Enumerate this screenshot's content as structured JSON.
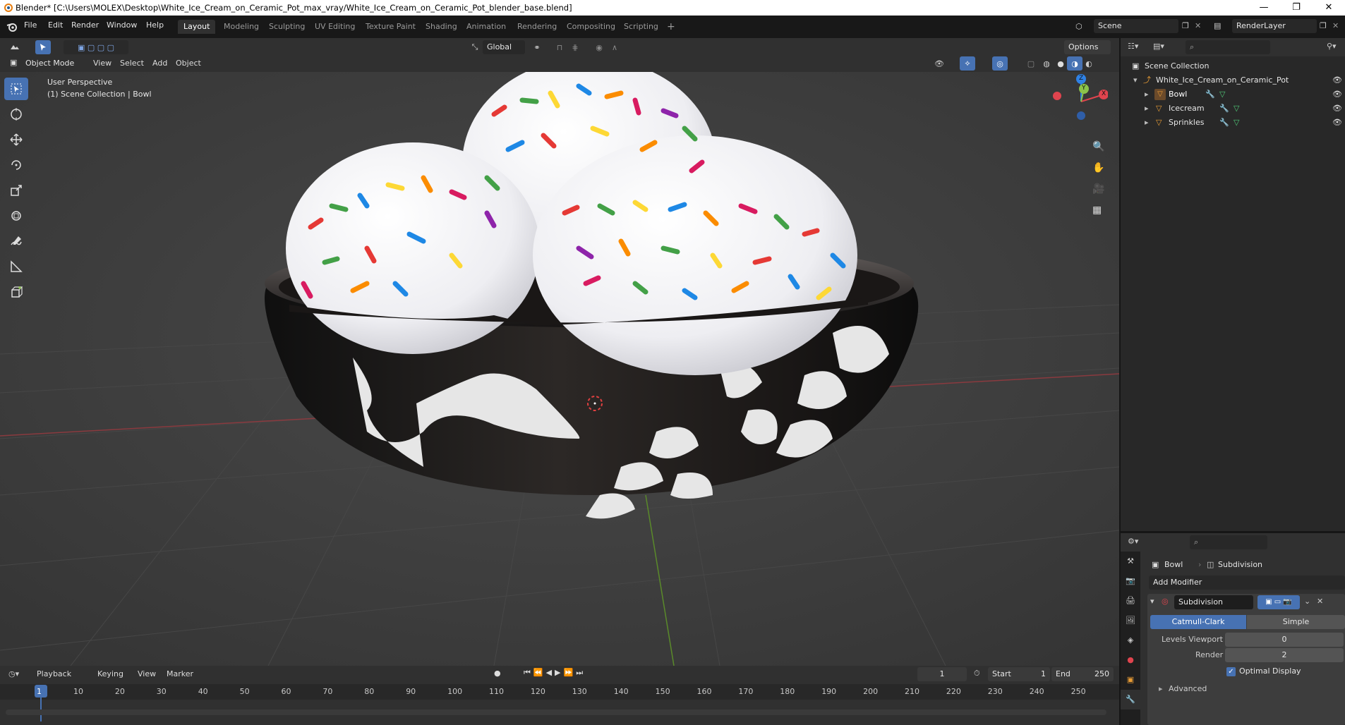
{
  "window": {
    "title": "Blender* [C:\\Users\\MOLEX\\Desktop\\White_Ice_Cream_on_Ceramic_Pot_max_vray/White_Ice_Cream_on_Ceramic_Pot_blender_base.blend]",
    "minimize": "—",
    "restore": "❐",
    "close": "✕"
  },
  "menu": {
    "items": [
      "File",
      "Edit",
      "Render",
      "Window",
      "Help"
    ]
  },
  "workspaces": {
    "tabs": [
      "Layout",
      "Modeling",
      "Sculpting",
      "UV Editing",
      "Texture Paint",
      "Shading",
      "Animation",
      "Rendering",
      "Compositing",
      "Scripting"
    ],
    "active": "Layout",
    "add": "+"
  },
  "scene": {
    "name": "Scene",
    "view_layer": "RenderLayer"
  },
  "viewport_header": {
    "transform_orientation": "Global",
    "options": "Options",
    "mode": "Object Mode",
    "menus": [
      "View",
      "Select",
      "Add",
      "Object"
    ]
  },
  "viewport": {
    "perspective": "User Perspective",
    "collection_info": "(1) Scene Collection | Bowl",
    "gizmo": {
      "x": "X",
      "y": "Y",
      "z": "Z"
    }
  },
  "outliner": {
    "root": "Scene Collection",
    "collection": "White_Ice_Cream_on_Ceramic_Pot",
    "objects": [
      "Bowl",
      "Icecream",
      "Sprinkles"
    ]
  },
  "properties": {
    "object": "Bowl",
    "modifier_name": "Subdivision",
    "add_modifier": "Add Modifier",
    "modifier_field": "Subdivision",
    "types": [
      "Catmull-Clark",
      "Simple"
    ],
    "active_type": "Catmull-Clark",
    "levels_viewport_label": "Levels Viewport",
    "levels_viewport": "0",
    "render_label": "Render",
    "render_levels": "2",
    "optimal_display": "Optimal Display",
    "advanced": "Advanced"
  },
  "timeline": {
    "menus": [
      "Playback",
      "Keying",
      "View",
      "Marker"
    ],
    "current_frame": "1",
    "start_label": "Start",
    "start": "1",
    "end_label": "End",
    "end": "250",
    "ticks": [
      "1",
      "10",
      "20",
      "30",
      "40",
      "50",
      "60",
      "70",
      "80",
      "90",
      "100",
      "110",
      "120",
      "130",
      "140",
      "150",
      "160",
      "170",
      "180",
      "190",
      "200",
      "210",
      "220",
      "230",
      "240",
      "250"
    ]
  },
  "colors": {
    "accent": "#4772b3",
    "axis_x": "#e0444e",
    "axis_y": "#8bc34a",
    "axis_z": "#2f82e6"
  }
}
